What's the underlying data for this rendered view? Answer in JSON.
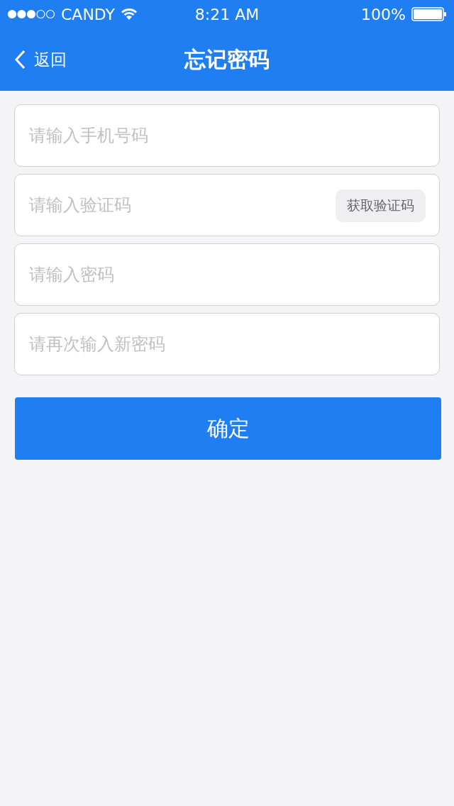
{
  "status_bar": {
    "carrier": "CANDY",
    "time": "8:21 AM",
    "battery": "100%"
  },
  "nav": {
    "back": "返回",
    "title": "忘记密码"
  },
  "fields": [
    {
      "placeholder": "请输入手机号码"
    },
    {
      "placeholder": "请输入验证码",
      "action": "获取验证码"
    },
    {
      "placeholder": "请输入密码"
    },
    {
      "placeholder": "请再次输入新密码"
    }
  ],
  "submit": "确定"
}
